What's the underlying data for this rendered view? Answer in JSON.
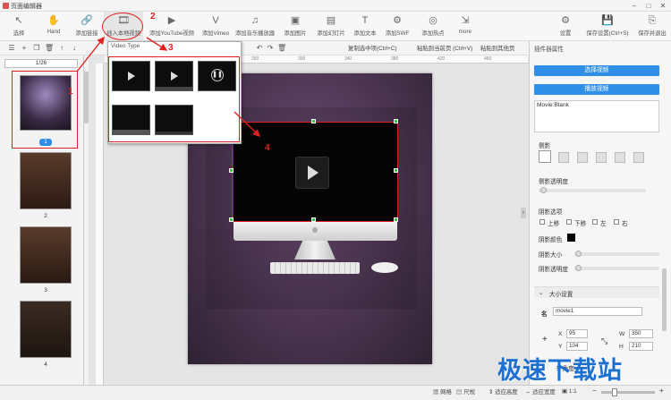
{
  "window": {
    "title": "页面编辑器"
  },
  "toolbar": {
    "items": [
      {
        "label": "选择",
        "icon": "cursor-icon",
        "glyph": "↖"
      },
      {
        "label": "Hand",
        "icon": "hand-icon",
        "glyph": "✋"
      },
      {
        "label": "添加链接",
        "icon": "link-icon",
        "glyph": "🔗"
      },
      {
        "label": "插入本地视频",
        "icon": "film-icon",
        "glyph": "🎞"
      },
      {
        "label": "添加YouTube视频",
        "icon": "youtube-icon",
        "glyph": "▶"
      },
      {
        "label": "添加Vimeo",
        "icon": "vimeo-icon",
        "glyph": "V"
      },
      {
        "label": "添加音乐播放器",
        "icon": "music-icon",
        "glyph": "♫"
      },
      {
        "label": "添加图片",
        "icon": "image-icon",
        "glyph": "▣"
      },
      {
        "label": "添加幻灯片",
        "icon": "slideshow-icon",
        "glyph": "▤"
      },
      {
        "label": "添加文本",
        "icon": "text-icon",
        "glyph": "T"
      },
      {
        "label": "添加SWF",
        "icon": "swf-icon",
        "glyph": "⚙"
      },
      {
        "label": "添加热点",
        "icon": "hotspot-icon",
        "glyph": "◎"
      },
      {
        "label": "more",
        "icon": "more-icon",
        "glyph": "⇲"
      }
    ],
    "right_items": [
      {
        "label": "设置",
        "icon": "gear-icon",
        "glyph": "⚙"
      },
      {
        "label": "保存设置(Ctrl+S)",
        "icon": "save-icon",
        "glyph": "💾"
      },
      {
        "label": "保存并退出",
        "icon": "save-exit-icon",
        "glyph": "⎘"
      }
    ]
  },
  "bar2": {
    "copy_label": "复制选中项(Ctrl+C)",
    "paste_label": "粘贴到当前页 (Ctrl+V)",
    "paste_other_label": "粘贴到其他页"
  },
  "pages": {
    "indicator": "1/26",
    "thumbs": [
      {
        "num": "1",
        "selected": true
      },
      {
        "num": "2"
      },
      {
        "num": "3"
      },
      {
        "num": "4"
      }
    ]
  },
  "ruler": {
    "ticks": [
      "140",
      "180",
      "220",
      "260",
      "300",
      "340",
      "380",
      "420",
      "460"
    ]
  },
  "popup": {
    "title": "Video Type"
  },
  "annotations": {
    "a1": "1",
    "a2": "2",
    "a3": "3",
    "a4": "4"
  },
  "right_panel": {
    "header": "插件器属性",
    "select_video": "选择视频",
    "play_video": "播放视频",
    "movie_info": "Movie:Blank",
    "shadow_label": "侧影",
    "shadow_opacity_label": "侧影透明度",
    "inner_shadow_label": "阴影选项",
    "checks": [
      "上移",
      "下移",
      "左",
      "右"
    ],
    "shadow_color_label": "阴影颜色",
    "shadow_size_label": "阴影大小",
    "shadow_alpha_label": "阴影透明度",
    "size_section": "大小设置",
    "name_label": "名",
    "name_value": "movie1",
    "x_label": "X",
    "x_value": "95",
    "y_label": "Y",
    "y_value": "104",
    "w_label": "W",
    "w_value": "350",
    "h_label": "H",
    "h_value": "210",
    "rotate_label": "转角度"
  },
  "status": {
    "grid": "网格",
    "ruler": "尺规",
    "fit_height": "适应高度",
    "fit_width": "适应宽度",
    "ratio": "1:1"
  },
  "watermark": "极速下载站"
}
